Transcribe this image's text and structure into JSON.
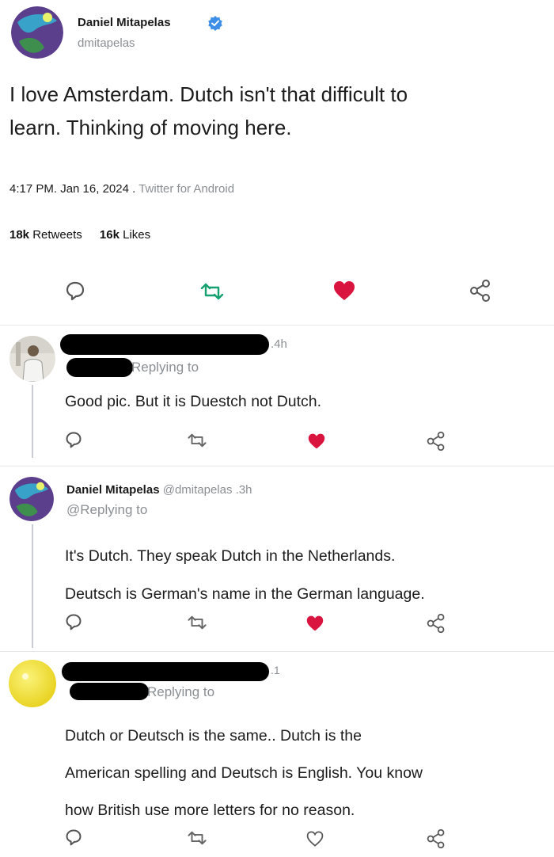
{
  "tweet": {
    "author_name": "Daniel Mitapelas",
    "author_handle": "dmitapelas",
    "text_line1": "I love Amsterdam. Dutch isn't that difficult to",
    "text_line2": "learn. Thinking of moving here.",
    "time": "4:17 PM. Jan 16, 2024 .",
    "source": "Twitter for Android",
    "retweets_count": "18k",
    "retweets_label": "Retweets",
    "likes_count": "16k",
    "likes_label": "Likes",
    "liked": true
  },
  "replies": [
    {
      "time": ".4h",
      "replying_to": "Replying to",
      "lines": [
        "Good pic. But it is Duestch not Dutch."
      ],
      "liked": true
    },
    {
      "author_name": "Daniel Mitapelas",
      "author_handle": "@dmitapelas",
      "time": ".3h",
      "replying_to": "@Replying to",
      "lines": [
        "It's Dutch. They speak Dutch in the Netherlands.",
        "Deutsch is German's name in the German language."
      ],
      "liked": true
    },
    {
      "time": ".1",
      "replying_to": "Replying to",
      "lines": [
        "Dutch or Deutsch is the same.. Dutch is the",
        "American spelling and Deutsch is English. You know",
        "how British use more letters for no reason."
      ],
      "liked": false
    }
  ],
  "icons": {
    "reply": "reply-icon",
    "retweet": "retweet-icon",
    "like": "heart-icon",
    "share": "share-icon",
    "verified": "verified-badge-icon"
  },
  "colors": {
    "like_red": "#d9143f",
    "retweet_green": "#17a070",
    "link_gray": "#8a8f94"
  }
}
